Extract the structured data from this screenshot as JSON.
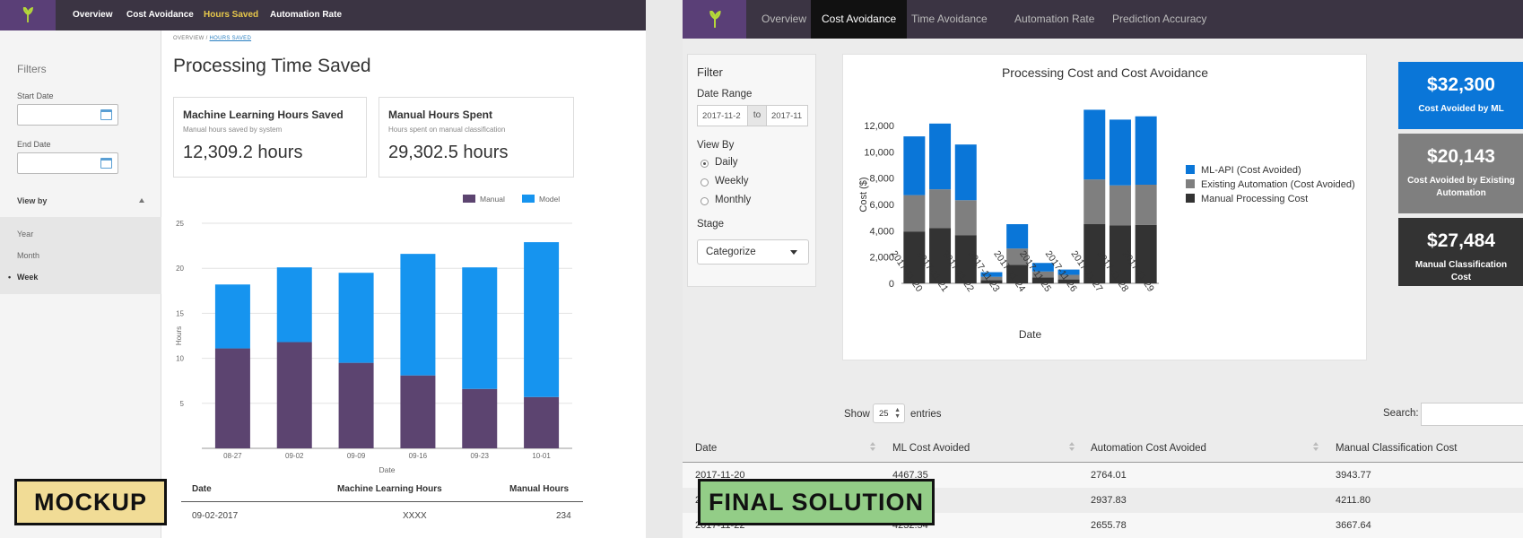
{
  "mockup": {
    "nav": [
      "Overview",
      "Cost Avoidance",
      "Hours Saved",
      "Automation Rate"
    ],
    "active_nav_index": 2,
    "sidebar": {
      "title": "Filters",
      "start_date_label": "Start Date",
      "end_date_label": "End Date",
      "view_by_label": "View by",
      "view_by_options": [
        "Year",
        "Month",
        "Week"
      ],
      "selected_view": "Week"
    },
    "breadcrumb": {
      "parent": "OVERVIEW",
      "separator": "/",
      "current": "HOURS SAVED"
    },
    "page_title": "Processing Time Saved",
    "cards": [
      {
        "title": "Machine Learning Hours Saved",
        "subtitle": "Manual hours saved by system",
        "value": "12,309.2 hours"
      },
      {
        "title": "Manual Hours Spent",
        "subtitle": "Hours spent on manual classification",
        "value": "29,302.5 hours"
      }
    ],
    "table": {
      "headers": [
        "Date",
        "Machine Learning Hours",
        "Manual Hours"
      ],
      "rows": [
        [
          "09-02-2017",
          "XXXX",
          "234"
        ]
      ]
    },
    "label": "MOCKUP"
  },
  "final": {
    "nav": [
      "Overview",
      "Cost Avoidance",
      "Time Avoidance",
      "Automation Rate",
      "Prediction Accuracy"
    ],
    "active_nav_index": 1,
    "filter": {
      "title": "Filter",
      "date_range_label": "Date Range",
      "start_value": "2017-11-2",
      "to_label": "to",
      "end_value": "2017-11",
      "view_by_label": "View By",
      "view_options": [
        "Daily",
        "Weekly",
        "Monthly"
      ],
      "selected_view": "Daily",
      "stage_label": "Stage",
      "stage_value": "Categorize"
    },
    "kpis": [
      {
        "value": "$32,300",
        "label": "Cost Avoided by ML",
        "color": "#0a76d8"
      },
      {
        "value": "$20,143",
        "label": "Cost Avoided by Existing Automation",
        "color": "#7f7f7f"
      },
      {
        "value": "$27,484",
        "label": "Manual Classification Cost",
        "color": "#333333"
      }
    ],
    "table_controls": {
      "show": "Show",
      "entries_value": "25",
      "entries": "entries",
      "search": "Search:"
    },
    "table": {
      "headers": [
        "Date",
        "ML Cost Avoided",
        "Automation Cost Avoided",
        "Manual Classification Cost"
      ],
      "rows": [
        [
          "2017-11-20",
          "4467.35",
          "2764.01",
          "3943.77"
        ],
        [
          "2017-11-21",
          "",
          "2937.83",
          "4211.80"
        ],
        [
          "2017-11-22",
          "4232.54",
          "2655.78",
          "3667.64"
        ]
      ]
    },
    "label": "FINAL SOLUTION"
  },
  "colors": {
    "manual": "#5c4470",
    "model": "#1694ef",
    "ml_api": "#0a76d8",
    "existing_automation": "#7f7f7f",
    "manual_processing": "#333333",
    "mockup_label_bg": "#f1dc96",
    "final_label_bg": "#93cd87"
  },
  "chart_data": [
    {
      "type": "bar",
      "stacked": true,
      "categories": [
        "08-27",
        "09-02",
        "09-09",
        "09-16",
        "09-23",
        "10-01"
      ],
      "series": [
        {
          "name": "Manual",
          "values": [
            11.1,
            11.8,
            9.5,
            8.1,
            6.6,
            5.7
          ]
        },
        {
          "name": "Model",
          "values": [
            7.1,
            8.3,
            10.0,
            13.5,
            13.5,
            17.2
          ]
        }
      ],
      "title": "",
      "xlabel": "Date",
      "ylabel": "Hours",
      "ylim": [
        0,
        25
      ],
      "yticks": [
        5,
        10,
        15,
        20,
        25
      ],
      "grid": true,
      "legend": "top-right"
    },
    {
      "type": "bar",
      "stacked": true,
      "categories": [
        "2017-11-20",
        "2017-11-21",
        "2017-11-22",
        "2017-11-23",
        "2017-11-24",
        "2017-11-25",
        "2017-11-26",
        "2017-11-27",
        "2017-11-28",
        "2017-11-29"
      ],
      "series": [
        {
          "name": "Manual Processing Cost",
          "values": [
            3944,
            4212,
            3668,
            250,
            1400,
            450,
            300,
            4500,
            4400,
            4450
          ]
        },
        {
          "name": "Existing Automation (Cost Avoided)",
          "values": [
            2764,
            2938,
            2656,
            250,
            1250,
            450,
            350,
            3400,
            3050,
            3050
          ]
        },
        {
          "name": "ML-API (Cost Avoided)",
          "values": [
            4467,
            5000,
            4233,
            350,
            1850,
            650,
            400,
            5300,
            5000,
            5200
          ]
        }
      ],
      "title": "Processing Cost and Cost Avoidance",
      "xlabel": "Date",
      "ylabel": "Cost ($)",
      "ylim": [
        0,
        13500
      ],
      "yticks": [
        0,
        2000,
        4000,
        6000,
        8000,
        10000,
        12000
      ],
      "ytick_labels": [
        "0",
        "2,000",
        "4,000",
        "6,000",
        "8,000",
        "10,000",
        "12,000"
      ],
      "legend": "right"
    }
  ]
}
